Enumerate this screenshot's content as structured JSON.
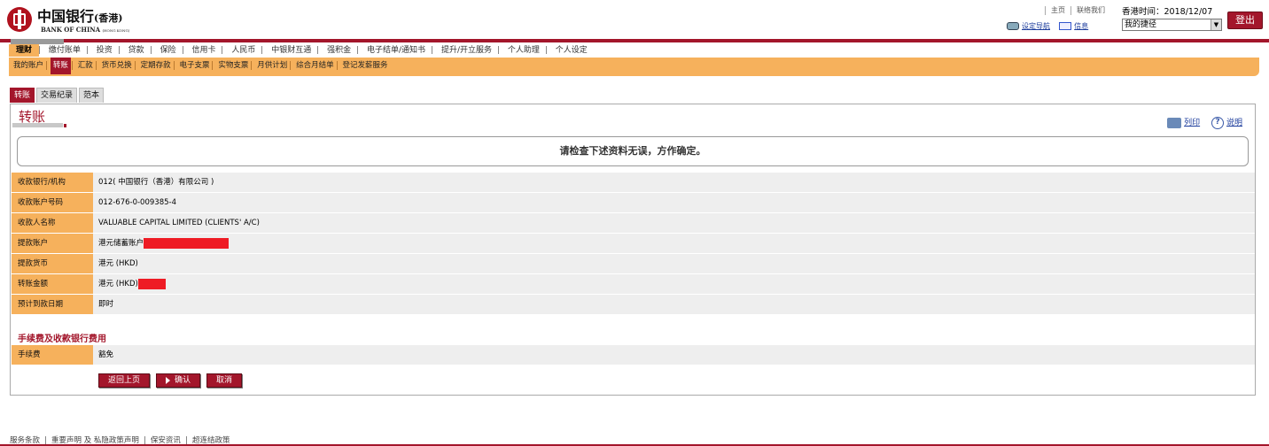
{
  "brand": {
    "name_cn": "中国银行",
    "name_cn_suffix": "(香港)",
    "name_en": "BANK OF CHINA",
    "name_en_suffix": "(HONG KONG)"
  },
  "top_links": {
    "home": "主页",
    "contact": "联络我们"
  },
  "time": {
    "label": "香港时间：",
    "value": "2018/12/07"
  },
  "util": {
    "settings": "设定导航",
    "messages": "信息"
  },
  "shortcut": {
    "selected": "我的捷径"
  },
  "logout_label": "登出",
  "nav_main": [
    "理财",
    "缴付账单",
    "投资",
    "贷款",
    "保险",
    "信用卡",
    "人民币",
    "中银财互通",
    "强积金",
    "电子结单/通知书",
    "提升/开立服务",
    "个人助理",
    "个人设定"
  ],
  "nav_sub": [
    "我的账户",
    "转账",
    "汇款",
    "货币兑换",
    "定期存款",
    "电子支票",
    "实物支票",
    "月供计划",
    "综合月结单",
    "登记发薪服务"
  ],
  "tabs": [
    "转账",
    "交易纪录",
    "范本"
  ],
  "panel": {
    "title": "转账",
    "print": "列印",
    "help": "说明",
    "notice": "请检查下述资料无误，方作确定。"
  },
  "details": [
    {
      "label": "收款银行/机构",
      "value": "012( 中国银行（香港）有限公司 )"
    },
    {
      "label": "收款账户号码",
      "value": "012-676-0-009385-4"
    },
    {
      "label": "收款人名称",
      "value": "VALUABLE CAPITAL LIMITED (CLIENTS' A/C)"
    },
    {
      "label": "提款账户",
      "value": "港元储蓄账户"
    },
    {
      "label": "提款货币",
      "value": "港元 (HKD)"
    },
    {
      "label": "转账金额",
      "value": "港元 (HKD)"
    },
    {
      "label": "预计到款日期",
      "value": "即时"
    }
  ],
  "fees": {
    "heading": "手续费及收款银行费用",
    "label": "手续费",
    "value": "豁免"
  },
  "buttons": {
    "back": "返回上页",
    "confirm": "确认",
    "cancel": "取消"
  },
  "footer": [
    "服务条款",
    "重要声明 及 私隐政策声明",
    "保安资讯",
    "超连结政策"
  ],
  "colors": {
    "brand_red": "#a3162b",
    "nav_orange": "#f6b15c",
    "redaction": "#ee1b24"
  }
}
